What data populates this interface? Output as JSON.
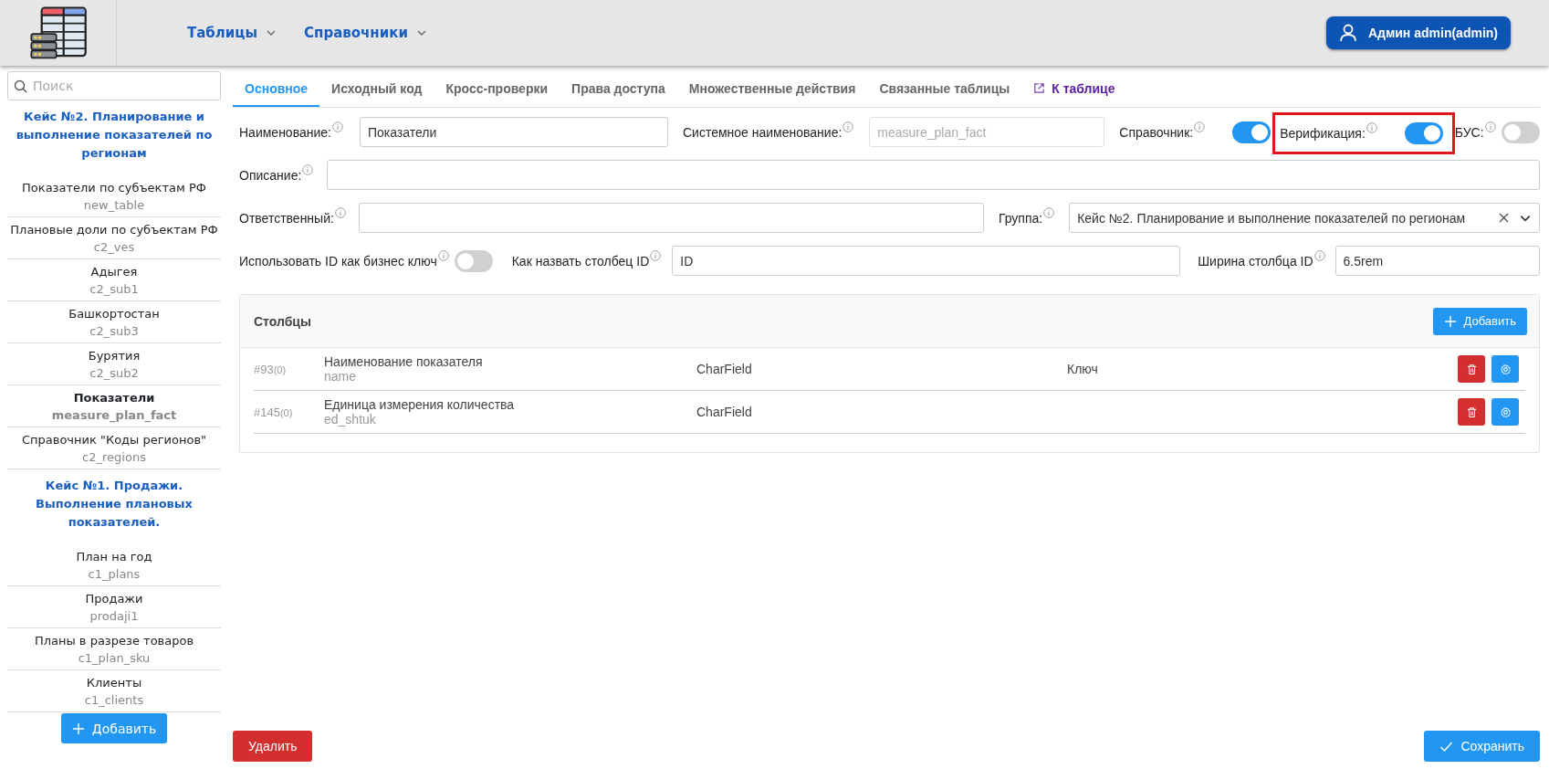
{
  "header": {
    "nav": [
      {
        "label": "Таблицы"
      },
      {
        "label": "Справочники"
      }
    ],
    "user": "Админ admin(admin)"
  },
  "sidebar": {
    "search": {
      "placeholder": "Поиск"
    },
    "groups": [
      {
        "title": "Кейс №2. Планирование и выполнение показателей по регионам",
        "items": [
          {
            "name": "Показатели по субъектам РФ",
            "code": "new_table",
            "selected": false
          },
          {
            "name": "Плановые доли по субъектам РФ",
            "code": "c2_ves",
            "selected": false
          },
          {
            "name": "Адыгея",
            "code": "c2_sub1",
            "selected": false
          },
          {
            "name": "Башкортостан",
            "code": "c2_sub3",
            "selected": false
          },
          {
            "name": "Бурятия",
            "code": "c2_sub2",
            "selected": false
          },
          {
            "name": "Показатели",
            "code": "measure_plan_fact",
            "selected": true
          },
          {
            "name": "Справочник \"Коды регионов\"",
            "code": "c2_regions",
            "selected": false
          }
        ]
      },
      {
        "title": "Кейс №1. Продажи. Выполнение плановых показателей.",
        "items": [
          {
            "name": "План на год",
            "code": "c1_plans",
            "selected": false
          },
          {
            "name": "Продажи",
            "code": "prodaji1",
            "selected": false
          },
          {
            "name": "Планы в разрезе товаров",
            "code": "c1_plan_sku",
            "selected": false
          },
          {
            "name": "Клиенты",
            "code": "c1_clients",
            "selected": false
          }
        ]
      }
    ],
    "add_button": "Добавить"
  },
  "tabs": [
    {
      "label": "Основное",
      "selected": true,
      "kind": "tab"
    },
    {
      "label": "Исходный код",
      "selected": false,
      "kind": "tab"
    },
    {
      "label": "Кросс-проверки",
      "selected": false,
      "kind": "tab"
    },
    {
      "label": "Права доступа",
      "selected": false,
      "kind": "tab"
    },
    {
      "label": "Множественные действия",
      "selected": false,
      "kind": "tab"
    },
    {
      "label": "Связанные таблицы",
      "selected": false,
      "kind": "tab"
    },
    {
      "label": "К таблице",
      "selected": false,
      "kind": "link"
    }
  ],
  "form": {
    "rows": [
      {
        "fields": [
          {
            "kind": "text",
            "label": "Наименование:",
            "value": "Показатели",
            "disabled": false
          },
          {
            "kind": "text",
            "label": "Системное наименование:",
            "value": "measure_plan_fact",
            "disabled": true
          },
          {
            "kind": "toggle",
            "label": "Справочник:",
            "on": true,
            "highlighted": false
          },
          {
            "kind": "toggle",
            "label": "Верификация:",
            "on": true,
            "highlighted": true
          },
          {
            "kind": "toggle",
            "label": "БУС:",
            "on": false,
            "highlighted": false
          }
        ]
      },
      {
        "fields": [
          {
            "kind": "text",
            "label": "Описание:",
            "disabled": false
          }
        ]
      },
      {
        "fields": [
          {
            "kind": "text",
            "label": "Ответственный:",
            "disabled": false
          },
          {
            "kind": "select",
            "label": "Группа:",
            "value": "Кейс №2. Планирование и выполнение показателей по регионам"
          }
        ]
      },
      {
        "fields": [
          {
            "kind": "toggle",
            "label": "Использовать ID как бизнес ключ",
            "on": false,
            "highlighted": false
          },
          {
            "kind": "text",
            "label": "Как назвать столбец ID",
            "value": "ID",
            "disabled": false
          },
          {
            "kind": "text",
            "label": "Ширина столбца ID",
            "value": "6.5rem",
            "disabled": false
          }
        ]
      }
    ]
  },
  "columns_panel": {
    "title": "Столбцы",
    "add_button": "Добавить",
    "rows": [
      {
        "id": "#93",
        "count": "(0)",
        "name": "Наименование показателя",
        "code": "name",
        "type": "CharField",
        "column_4": "Ключ"
      },
      {
        "id": "#145",
        "count": "(0)",
        "name": "Единица измерения количества",
        "code": "ed_shtuk",
        "type": "CharField"
      }
    ]
  },
  "footer": {
    "delete_button": "Удалить",
    "save_button": "Сохранить"
  }
}
